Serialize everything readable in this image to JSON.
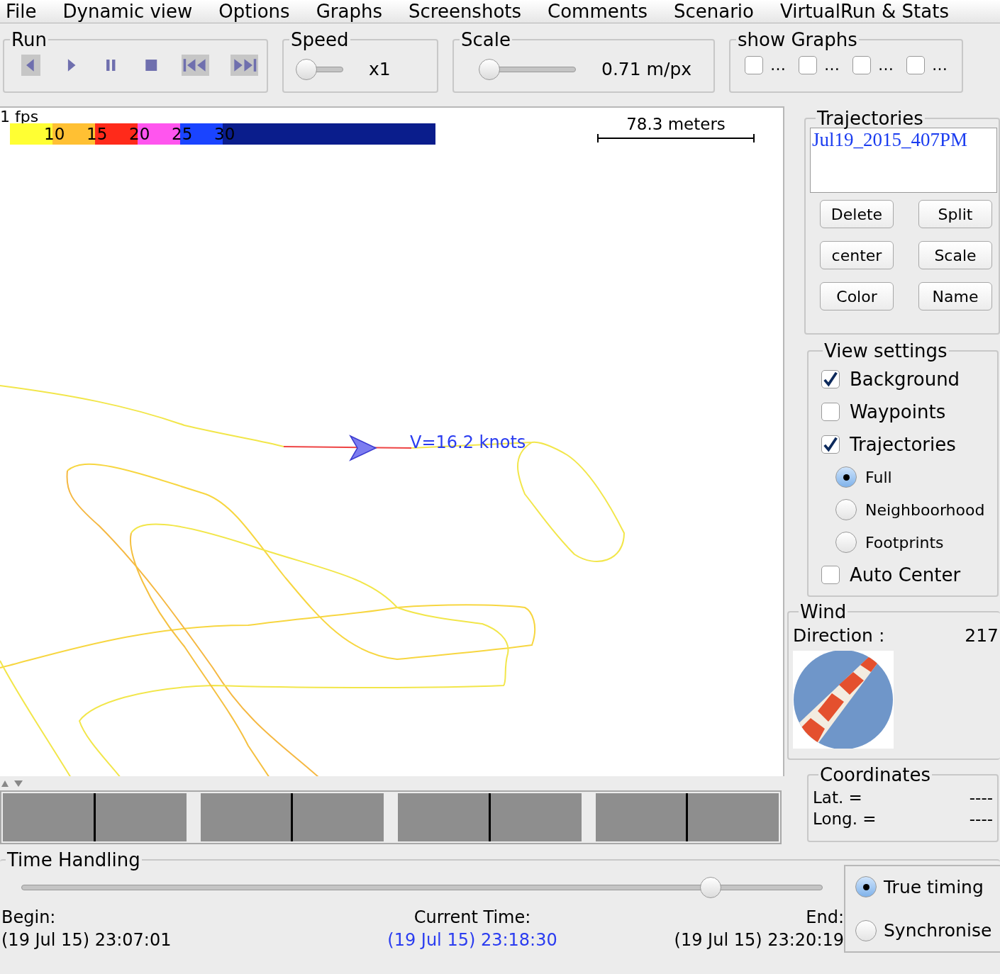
{
  "menu": [
    "File",
    "Dynamic view",
    "Options",
    "Graphs",
    "Screenshots",
    "Comments",
    "Scenario",
    "VirtualRun & Stats"
  ],
  "run": {
    "title": "Run"
  },
  "speed": {
    "title": "Speed",
    "level": 0.1,
    "value": "x1"
  },
  "scale": {
    "title": "Scale",
    "level": 0.05,
    "value": "0.71 m/px"
  },
  "show_graphs": {
    "title": "show Graphs",
    "items": [
      {
        "label": "…",
        "checked": false
      },
      {
        "label": "…",
        "checked": false
      },
      {
        "label": "…",
        "checked": false
      },
      {
        "label": "…",
        "checked": false
      }
    ]
  },
  "map": {
    "fps": "1 fps",
    "scale_label": "78.3 meters",
    "speed_label": "V=16.2 knots",
    "legend": [
      {
        "color": "#ffff33"
      },
      {
        "color": "#ffc033",
        "label": "10"
      },
      {
        "color": "#ff2a1a",
        "label": "15"
      },
      {
        "color": "#ff55ee",
        "label": "20"
      },
      {
        "color": "#1a44ff",
        "label": "25"
      },
      {
        "color": "#0a1d8c",
        "label": "30"
      }
    ]
  },
  "trajectories": {
    "title": "Trajectories",
    "items": [
      {
        "label": "Jul19_2015_407PM",
        "selected": false
      }
    ],
    "buttons": [
      "Delete",
      "Split",
      "center",
      "Scale",
      "Color",
      "Name"
    ]
  },
  "view_settings": {
    "title": "View settings",
    "items": [
      {
        "kind": "checkbox",
        "label": "Background",
        "checked": true
      },
      {
        "kind": "checkbox",
        "label": "Waypoints",
        "checked": false
      },
      {
        "kind": "checkbox",
        "label": "Trajectories",
        "checked": true
      },
      {
        "kind": "radio",
        "label": "Full",
        "selected": true
      },
      {
        "kind": "radio",
        "label": "Neighboorhood",
        "selected": false
      },
      {
        "kind": "radio",
        "label": "Footprints",
        "selected": false
      },
      {
        "kind": "checkbox",
        "label": "Auto Center",
        "checked": false
      }
    ]
  },
  "wind": {
    "title": "Wind",
    "direction_label": "Direction :",
    "direction_value": "217"
  },
  "coordinates": {
    "title": "Coordinates",
    "rows": [
      {
        "label": "Lat. =",
        "value": "----"
      },
      {
        "label": "Long. =",
        "value": "----"
      }
    ]
  },
  "time_handling": {
    "title": "Time Handling",
    "level": 0.86,
    "begin_label": "Begin:",
    "begin": "(19 Jul 15) 23:07:01",
    "current_label": "Current Time:",
    "current": "(19 Jul 15) 23:18:30",
    "end_label": "End:",
    "end": "(19 Jul 15) 23:20:19",
    "timing": [
      {
        "label": "True timing",
        "selected": true
      },
      {
        "label": "Synchronise",
        "selected": false
      }
    ]
  }
}
